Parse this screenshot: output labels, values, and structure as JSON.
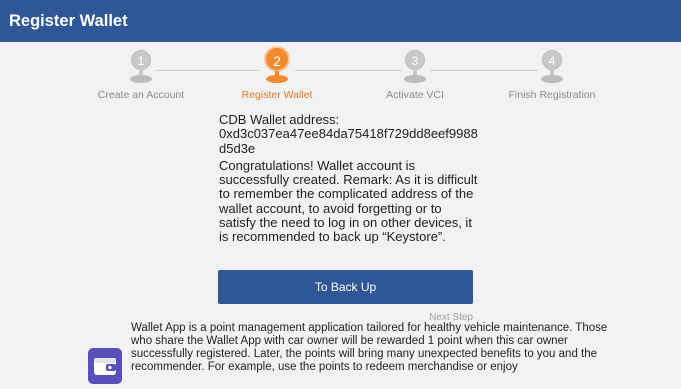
{
  "header": {
    "title": "Register Wallet"
  },
  "steps": [
    {
      "number": "1",
      "label": "Create an Account",
      "active": false
    },
    {
      "number": "2",
      "label": "Register Wallet",
      "active": true
    },
    {
      "number": "3",
      "label": "Activate VCI",
      "active": false
    },
    {
      "number": "4",
      "label": "Finish Registration",
      "active": false
    }
  ],
  "wallet": {
    "address_label": "CDB Wallet address:",
    "address": "0xd3c037ea47ee84da75418f729dd8eef9988d5d3e",
    "message": "Congratulations! Wallet account is successfully created. Remark: As it is difficult to remember the complicated address of the wallet account, to avoid forgetting or to satisfy the need to log in on other devices, it is recommended to back up “Keystore”."
  },
  "buttons": {
    "backup_label": "To Back Up",
    "next_label": "Next Step"
  },
  "promo": {
    "icon": "wallet-app-icon",
    "text": "Wallet App is a point management application tailored for healthy vehicle maintenance. Those who share the Wallet App with car owner will be rewarded 1 point when this car owner successfully registered. Later, the points will bring many unexpected benefits to you and the recommender. For example, use the points to redeem merchandise or enjoy"
  },
  "colors": {
    "header": "#2f5797",
    "active_step": "#f28a2e",
    "inactive_step": "#c9c9c9",
    "button": "#2f5797"
  }
}
